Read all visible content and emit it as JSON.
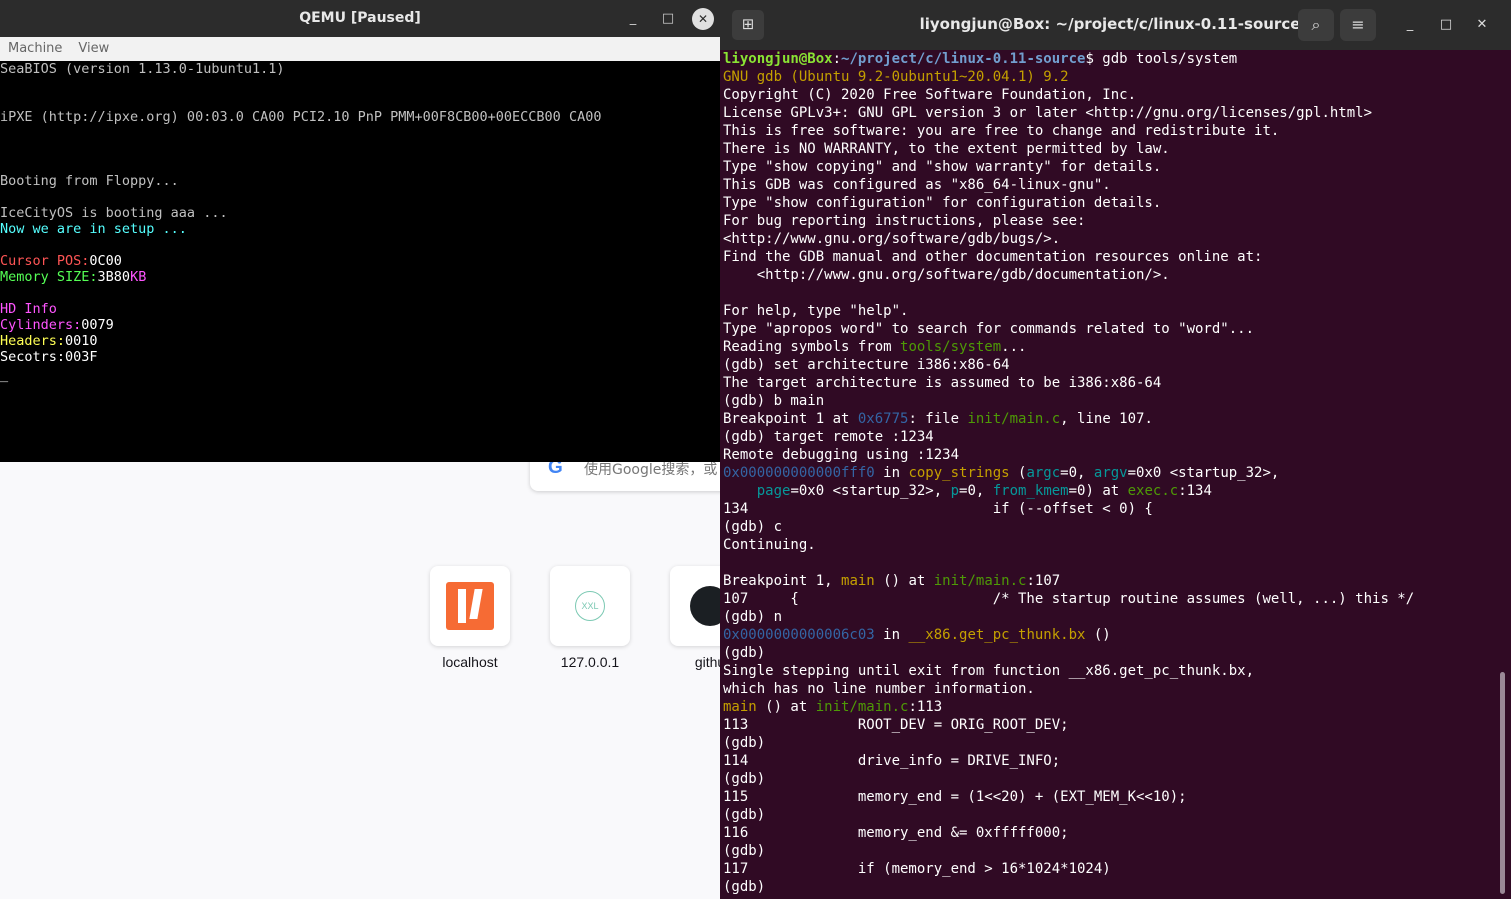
{
  "browser": {
    "search_placeholder": "使用Google搜索，或",
    "search_engine_glyph": "G",
    "shortcuts": [
      {
        "label": "localhost",
        "icon": "localhost-icon"
      },
      {
        "label": "127.0.0.1",
        "icon_text": "XXL"
      },
      {
        "label": "githu",
        "icon": "github-icon"
      }
    ]
  },
  "qemu": {
    "title": "QEMU [Paused]",
    "menu": [
      "Machine",
      "View"
    ],
    "controls": {
      "minimize": "_",
      "maximize": "□",
      "close": "✕"
    },
    "screen": {
      "seabios": "SeaBIOS (version 1.13.0-1ubuntu1.1)",
      "ipxe": "iPXE (http://ipxe.org) 00:03.0 CA00 PCI2.10 PnP PMM+00F8CB00+00ECCB00 CA00",
      "booting": "Booting from Floppy...",
      "os_boot": "IceCityOS is booting aaa ...",
      "setup": "Now we are in setup ...",
      "cursor_label": "Cursor POS:",
      "cursor_value": "0C00",
      "memory_label": "Memory SIZE:",
      "memory_value": "3B80",
      "memory_unit": "KB",
      "hd_info": "HD Info",
      "cylinders_label": "Cylinders:",
      "cylinders_value": "0079",
      "headers_label": "Headers:",
      "headers_value": "0010",
      "sectors_label": "Secotrs:",
      "sectors_value": "003F",
      "cursor_glyph": "_"
    }
  },
  "terminal": {
    "title": "liyongjun@Box: ~/project/c/linux-0.11-source",
    "new_tab_glyph": "⊞",
    "search_glyph": "⌕",
    "menu_glyph": "≡",
    "controls": {
      "minimize": "_",
      "maximize": "□",
      "close": "✕"
    },
    "prompt_user": "liyongjun@Box",
    "prompt_sep": ":",
    "prompt_path": "~/project/c/linux-0.11-source",
    "prompt_cmd": "$ gdb tools/system",
    "version": "GNU gdb (Ubuntu 9.2-0ubuntu1~20.04.1) 9.2",
    "lines_a": [
      "Copyright (C) 2020 Free Software Foundation, Inc.",
      "License GPLv3+: GNU GPL version 3 or later <http://gnu.org/licenses/gpl.html>",
      "This is free software: you are free to change and redistribute it.",
      "There is NO WARRANTY, to the extent permitted by law.",
      "Type \"show copying\" and \"show warranty\" for details.",
      "This GDB was configured as \"x86_64-linux-gnu\".",
      "Type \"show configuration\" for configuration details.",
      "For bug reporting instructions, please see:",
      "<http://www.gnu.org/software/gdb/bugs/>.",
      "Find the GDB manual and other documentation resources online at:",
      "    <http://www.gnu.org/software/gdb/documentation/>.",
      "",
      "For help, type \"help\".",
      "Type \"apropos word\" to search for commands related to \"word\"..."
    ],
    "reading_pre": "Reading symbols from ",
    "reading_file": "tools/system",
    "reading_post": "...",
    "lines_b": [
      "(gdb) set architecture i386:x86-64",
      "The target architecture is assumed to be i386:x86-64",
      "(gdb) b main"
    ],
    "bp1_pre": "Breakpoint 1 at ",
    "bp1_addr": "0x6775",
    "bp1_mid": ": file ",
    "bp1_file": "init/main.c",
    "bp1_post": ", line 107.",
    "lines_c": [
      "(gdb) target remote :1234",
      "Remote debugging using :1234"
    ],
    "fr_addr": "0x000000000000fff0",
    "fr_in": " in ",
    "fr_func": "copy_strings",
    "fr_open": " (",
    "fr_arg1": "argc",
    "fr_arg1v": "=0, ",
    "fr_arg2": "argv",
    "fr_arg2v": "=0x0 <startup_32>,",
    "fr2_indent": "    ",
    "fr2_arg": "page",
    "fr2_argv": "=0x0 <startup_32>, ",
    "fr2_arg2": "p",
    "fr2_arg2v": "=0, ",
    "fr2_arg3": "from_kmem",
    "fr2_arg3v": "=0) at ",
    "fr2_file": "exec.c",
    "fr2_post": ":134",
    "lines_d": [
      "134                             if (--offset < 0) {",
      "(gdb) c",
      "Continuing.",
      ""
    ],
    "bp2_pre": "Breakpoint 1, ",
    "bp2_func": "main",
    "bp2_mid": " () at ",
    "bp2_file": "init/main.c",
    "bp2_post": ":107",
    "lines_e": [
      "107     {                       /* The startup routine assumes (well, ...) this */",
      "(gdb) n"
    ],
    "thunk_addr": "0x0000000000006c03",
    "thunk_in": " in ",
    "thunk_func": "__x86.get_pc_thunk.bx",
    "thunk_post": " ()",
    "lines_f": [
      "(gdb)",
      "Single stepping until exit from function __x86.get_pc_thunk.bx,",
      "which has no line number information."
    ],
    "main_func": "main",
    "main_mid": " () at ",
    "main_file": "init/main.c",
    "main_post": ":113",
    "lines_g": [
      "113             ROOT_DEV = ORIG_ROOT_DEV;",
      "(gdb)",
      "114             drive_info = DRIVE_INFO;",
      "(gdb)",
      "115             memory_end = (1<<20) + (EXT_MEM_K<<10);",
      "(gdb)",
      "116             memory_end &= 0xfffff000;",
      "(gdb)",
      "117             if (memory_end > 16*1024*1024)",
      "(gdb)"
    ]
  },
  "colors": {
    "terminal_bg": "#300a24",
    "prompt_user": "#8ae234",
    "prompt_path": "#729fcf",
    "address": "#3465a4",
    "function": "#c4a000",
    "file": "#4e9a06",
    "argument": "#06989a"
  }
}
